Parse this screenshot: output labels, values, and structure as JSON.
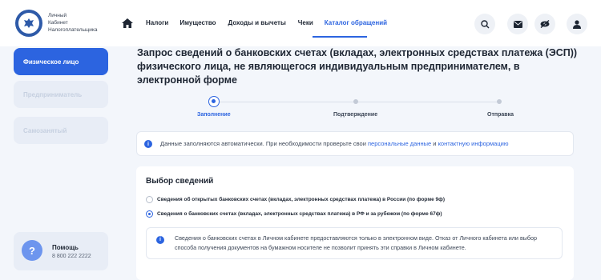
{
  "header": {
    "brand_lines": [
      "Личный",
      "Кабинет",
      "Налогоплательщика"
    ],
    "nav": [
      "Налоги",
      "Имущество",
      "Доходы и вычеты",
      "Чеки",
      "Каталог обращений"
    ],
    "active_nav": "Каталог обращений",
    "icons": [
      "search-icon",
      "mail-icon",
      "eye-off-icon",
      "user-icon"
    ]
  },
  "sidebar": {
    "items": [
      {
        "label": "Физическое лицо",
        "active": true
      },
      {
        "label": "Предприниматель",
        "active": false
      },
      {
        "label": "Самозанятый",
        "active": false
      }
    ],
    "help": {
      "title": "Помощь",
      "phone": "8 800 222 2222"
    }
  },
  "main": {
    "title": "Запрос сведений о банковских счетах (вкладах, электронных средствах платежа (ЭСП)) физического лица, не являющегося индивидуальным предпринимателем, в электронной форме",
    "steps": [
      {
        "label": "Заполнение",
        "active": true
      },
      {
        "label": "Подтверждение",
        "active": false
      },
      {
        "label": "Отправка",
        "active": false
      }
    ],
    "info": {
      "text_before": "Данные заполняются автоматически. При необходимости проверьте свои",
      "link1": "персональные данные",
      "text_mid": "и",
      "link2": "контактную информацию"
    },
    "selection": {
      "title": "Выбор сведений",
      "options": [
        {
          "label": "Сведения об открытых банковских счетах (вкладах, электронных средствах платежа) в России (по форме 9ф)",
          "checked": false
        },
        {
          "label": "Сведения о банковских счетах (вкладах, электронных средствах платежа) в РФ и за рубежом (по форме 67ф)",
          "checked": true
        }
      ],
      "notice": "Сведения о банковских счетах в Личном кабинете предоставляются только в электронном виде. Отказ от Личного кабинета или выбор способа получения документов на бумажном носителе не позволит принять эти справки в Личном кабинете."
    }
  },
  "colors": {
    "accent": "#2c64e0",
    "background": "#f3f6fb"
  }
}
